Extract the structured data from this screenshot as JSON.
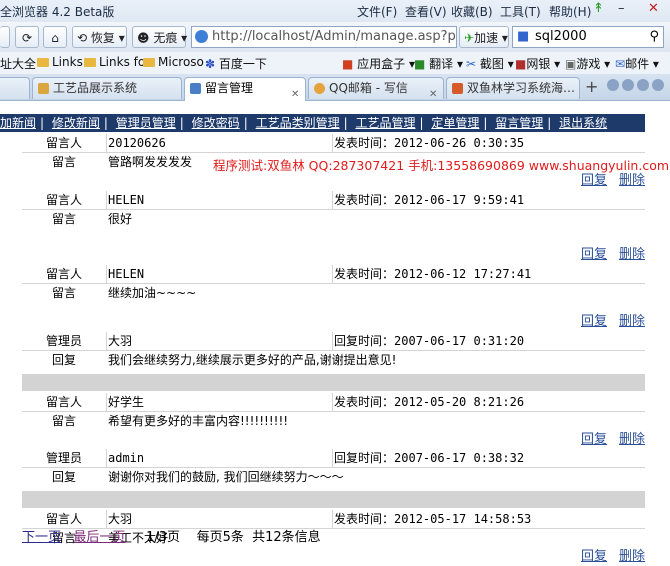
{
  "browser": {
    "title": "全浏览器 4.2 Beta版",
    "menu": [
      "文件(F)",
      "查看(V)",
      "收藏(B)",
      "工具(T)",
      "帮助(H)"
    ],
    "back_label": "恢复",
    "mode_label": "无痕",
    "address": "http://localhost/Admin/manage.asp?p",
    "accelerate_label": "加速",
    "search_value": "sql2000"
  },
  "bookmarks": {
    "left": [
      "址大全",
      "Links",
      "Links fo",
      "Microso",
      "百度一下"
    ],
    "right": [
      "应用盒子",
      "翻译",
      "截图",
      "网银",
      "游戏",
      "邮件"
    ]
  },
  "tabs": [
    {
      "label": "",
      "active": false
    },
    {
      "label": "工艺品展示系统",
      "active": false
    },
    {
      "label": "留言管理",
      "active": true
    },
    {
      "label": "QQ邮箱 - 写信",
      "active": false
    },
    {
      "label": "双鱼林学习系统海…",
      "active": false
    }
  ],
  "nav": [
    "加新闻",
    "修改新闻",
    "管理员管理",
    "修改密码",
    "工艺品类别管理",
    "工艺品管理",
    "定单管理",
    "留言管理",
    "退出系统"
  ],
  "labels": {
    "poster": "留言人",
    "message": "留言",
    "admin": "管理员",
    "reply": "回复",
    "post_time": "发表时间：",
    "reply_time": "回复时间：",
    "action_reply": "回复",
    "action_delete": "删除"
  },
  "watermark": "程序测试:双鱼林 QQ:287307421 手机:13558690869 www.shuangyulin.com",
  "messages": [
    {
      "poster": "20120626",
      "time": "2012-06-26 0:30:35",
      "content": "管路啊发发发发"
    },
    {
      "poster": "HELEN",
      "time": "2012-06-17 9:59:41",
      "content": "很好"
    },
    {
      "poster": "HELEN",
      "time": "2012-06-12 17:27:41",
      "content": "继续加油~~~~",
      "admin": "大羽",
      "reply_time": "2007-06-17 0:31:20",
      "reply": "我们会继续努力,继续展示更多好的产品,谢谢提出意见!"
    },
    {
      "poster": "好学生",
      "time": "2012-05-20 8:21:26",
      "content": "希望有更多好的丰富内容!!!!!!!!!!",
      "admin": "admin",
      "reply_time": "2007-06-17 0:38:32",
      "reply": "谢谢你对我们的鼓励, 我们回继续努力～～～"
    },
    {
      "poster": "大羽",
      "time": "2012-05-17 14:58:53",
      "content": "美工不太好"
    }
  ],
  "pager": {
    "next": "下一页",
    "last": "最后一页",
    "page": "1/3页",
    "per_page": "每页5条",
    "total": "共12条信息"
  }
}
